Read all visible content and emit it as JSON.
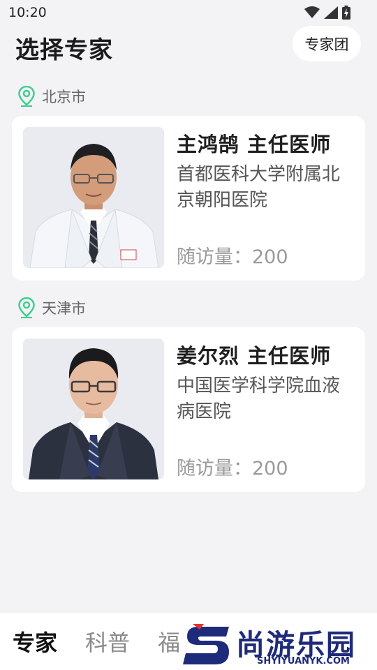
{
  "status_bar": {
    "time": "10:20"
  },
  "header": {
    "title": "选择专家",
    "team_button": "专家团"
  },
  "regions": [
    {
      "city": "北京市",
      "doctor": {
        "name_title": "主鸿鹄 主任医师",
        "hospital": "首都医科大学附属北京朝阳医院",
        "visits": "随访量：200"
      }
    },
    {
      "city": "天津市",
      "doctor": {
        "name_title": "姜尔烈 主任医师",
        "hospital": "中国医学科学院血液病医院",
        "visits": "随访量：200"
      }
    }
  ],
  "tabs": [
    "专家",
    "科普",
    "福"
  ],
  "watermark": {
    "text": "尚游乐园",
    "url": "SHYIYUANYK.COM"
  },
  "colors": {
    "location_icon": "#3ecf8e",
    "background": "#f3f3f6",
    "watermark": "#1e2a7a"
  }
}
